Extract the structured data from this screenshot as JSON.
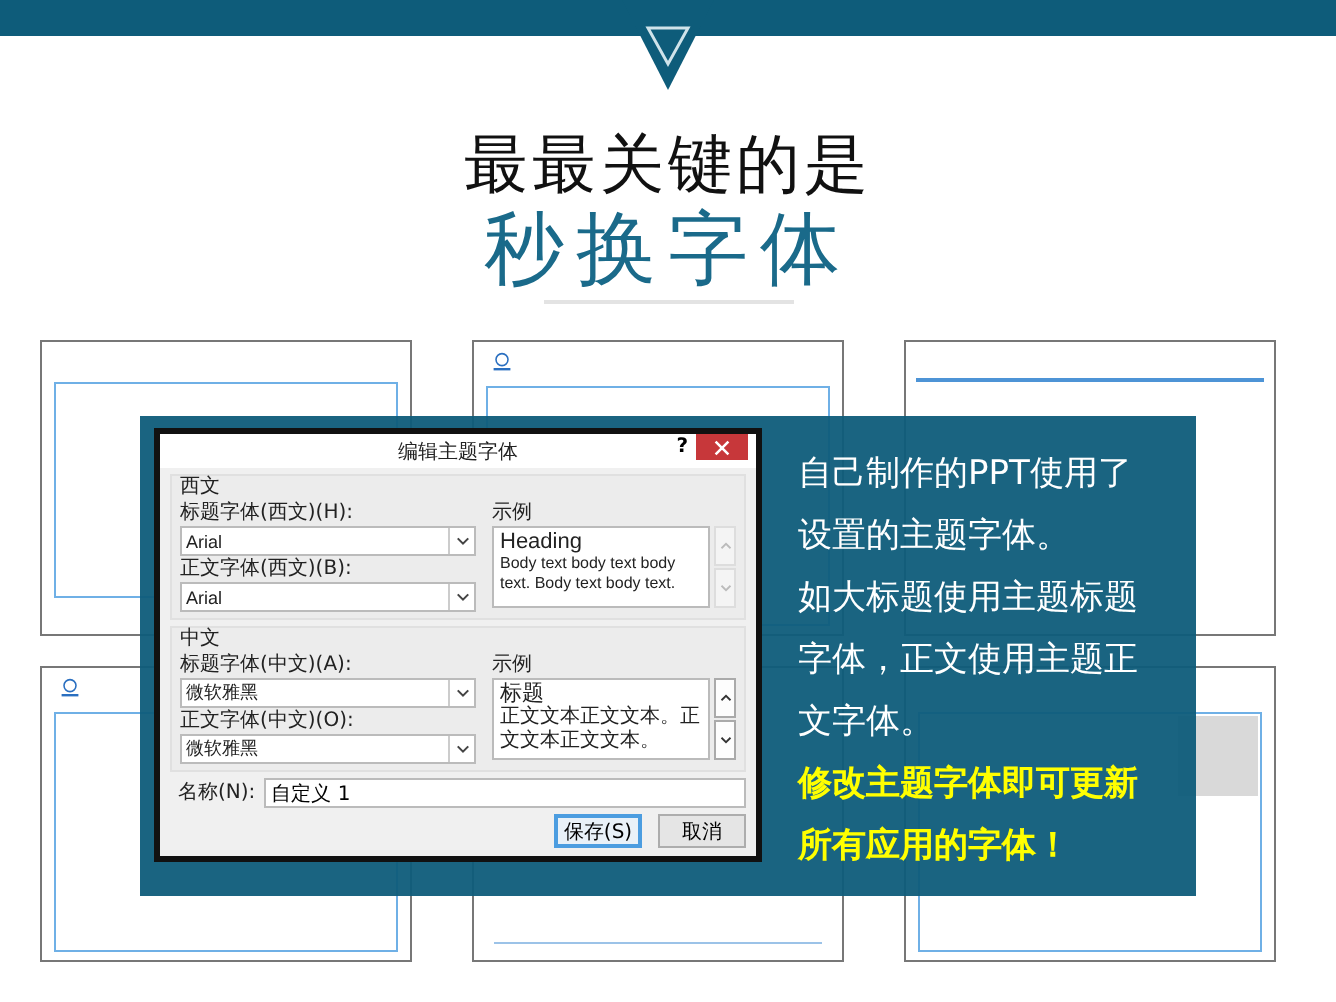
{
  "header": {
    "line1": "最最关键的是",
    "line2": "秒换字体"
  },
  "slides": [
    {
      "kind": "frame"
    },
    {
      "kind": "logo"
    },
    {
      "kind": "topline"
    },
    {
      "kind": "logo"
    },
    {
      "kind": "plain"
    },
    {
      "kind": "photo"
    }
  ],
  "dialog": {
    "title": "编辑主题字体",
    "help": "?",
    "groups": [
      {
        "legend": "西文",
        "heading_label": "标题字体(西文)(H):",
        "heading_value": "Arial",
        "body_label": "正文字体(西文)(B):",
        "body_value": "Arial",
        "sample_label": "示例",
        "sample_heading": "Heading",
        "sample_body": "Body text body text body text. Body text body text.",
        "scroll_enabled": false
      },
      {
        "legend": "中文",
        "heading_label": "标题字体(中文)(A):",
        "heading_value": "微软雅黑",
        "body_label": "正文字体(中文)(O):",
        "body_value": "微软雅黑",
        "sample_label": "示例",
        "sample_heading": "标题",
        "sample_body": "正文文本正文文本。正文文本正文文本。",
        "scroll_enabled": true
      }
    ],
    "name_label": "名称(N):",
    "name_value": "自定义 1",
    "buttons": [
      {
        "label": "保存(S)",
        "default": true
      },
      {
        "label": "取消",
        "default": false
      }
    ]
  },
  "note": [
    {
      "text": "自己制作的PPT使用了设置的主题字体。",
      "highlight": false
    },
    {
      "text": "如大标题使用主题标题字体，正文使用主题正文字体。",
      "highlight": false
    },
    {
      "text": "修改主题字体即可更新所有应用的字体！",
      "highlight": true
    }
  ]
}
